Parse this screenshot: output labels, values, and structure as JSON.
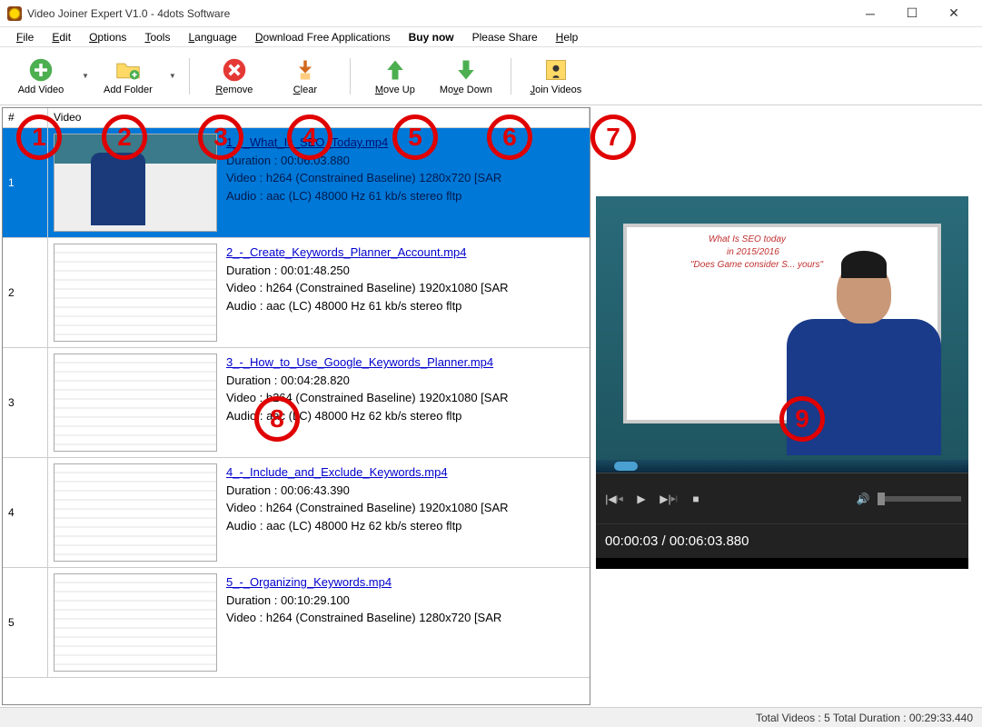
{
  "window": {
    "title": "Video Joiner Expert V1.0 - 4dots Software"
  },
  "menu": {
    "file": "File",
    "edit": "Edit",
    "options": "Options",
    "tools": "Tools",
    "language": "Language",
    "download": "Download Free Applications",
    "buy": "Buy now",
    "share": "Please Share",
    "help": "Help"
  },
  "toolbar": {
    "add_video": "Add Video",
    "add_folder": "Add Folder",
    "remove": "Remove",
    "clear": "Clear",
    "move_up": "Move Up",
    "move_down": "Move Down",
    "join": "Join Videos"
  },
  "columns": {
    "num": "#",
    "video": "Video"
  },
  "rows": [
    {
      "n": "1",
      "file": "1_-_What_Is_SEO_Today.mp4",
      "dur": "Duration : 00:06:03.880",
      "vid": "Video : h264 (Constrained Baseline) 1280x720 [SAR",
      "aud": "Audio : aac (LC) 48000 Hz 61 kb/s stereo fltp"
    },
    {
      "n": "2",
      "file": "2_-_Create_Keywords_Planner_Account.mp4",
      "dur": "Duration : 00:01:48.250",
      "vid": "Video : h264 (Constrained Baseline) 1920x1080 [SAR",
      "aud": "Audio : aac (LC) 48000 Hz 61 kb/s stereo fltp"
    },
    {
      "n": "3",
      "file": "3_-_How_to_Use_Google_Keywords_Planner.mp4",
      "dur": "Duration : 00:04:28.820",
      "vid": "Video : h264 (Constrained Baseline) 1920x1080 [SAR",
      "aud": "Audio : aac (LC) 48000 Hz 62 kb/s stereo fltp"
    },
    {
      "n": "4",
      "file": "4_-_Include_and_Exclude_Keywords.mp4",
      "dur": "Duration : 00:06:43.390",
      "vid": "Video : h264 (Constrained Baseline) 1920x1080 [SAR",
      "aud": "Audio : aac (LC) 48000 Hz 62 kb/s stereo fltp"
    },
    {
      "n": "5",
      "file": "5_-_Organizing_Keywords.mp4",
      "dur": "Duration : 00:10:29.100",
      "vid": "Video : h264 (Constrained Baseline) 1280x720 [SAR",
      "aud": ""
    }
  ],
  "player": {
    "time": "00:00:03 / 00:06:03.880"
  },
  "status": {
    "text": "Total Videos : 5  Total Duration : 00:29:33.440"
  },
  "annotations": [
    "1",
    "2",
    "3",
    "4",
    "5",
    "6",
    "7",
    "8",
    "9"
  ],
  "whiteboard": {
    "l1": "What Is SEO today",
    "l2": "in 2015/2016",
    "l3": "\"Does Game consider S... yours\""
  }
}
